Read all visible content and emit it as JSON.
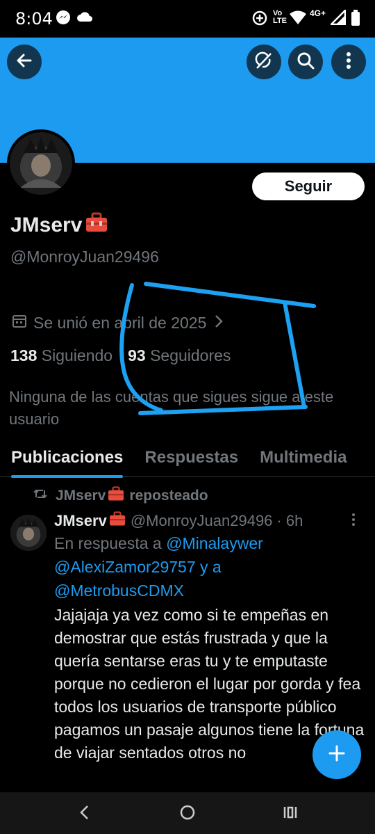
{
  "status_bar": {
    "time": "8:04",
    "network": "4G+"
  },
  "profile": {
    "display_name": "JMserv",
    "handle": "@MonroyJuan29496",
    "joined": "Se unió en abril de 2025",
    "following_count": "138",
    "following_label": "Siguiendo",
    "followers_count": "93",
    "followers_label": "Seguidores",
    "followers_note": "Ninguna de las cuentas que sigues sigue a este usuario",
    "follow_button": "Seguir"
  },
  "tabs": [
    {
      "label": "Publicaciones",
      "active": true
    },
    {
      "label": "Respuestas",
      "active": false
    },
    {
      "label": "Multimedia",
      "active": false
    }
  ],
  "tweet": {
    "repost_label": "JMserv",
    "repost_suffix": "reposteado",
    "author_name": "JMserv",
    "author_handle": "@MonroyJuan29496",
    "time": "· 6h",
    "reply_prefix": "En respuesta a",
    "mention_1": "@Minalaywer",
    "mention_2": "@AlexiZamor29757",
    "reply_and": "y a",
    "mention_3": "@MetrobusCDMX",
    "text": "Jajajaja ya vez como si te empeñas en demostrar que estás frustrada y que la quería sentarse eras tu y te emputaste porque no cedieron el lugar por gorda y fea todos los usuarios de transporte público pagamos un pasaje algunos tiene la fortuna de viajar sentados otros no"
  },
  "colors": {
    "accent": "#1d9bf0",
    "background": "#000000",
    "muted": "#71767b",
    "annotation": "#1da1f2"
  }
}
